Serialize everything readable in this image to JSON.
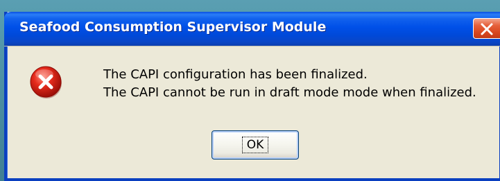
{
  "dialog": {
    "title": "Seafood Consumption Supervisor Module",
    "message_lines": [
      "The CAPI configuration has been finalized.",
      "The CAPI cannot be run in draft mode mode when finalized."
    ],
    "ok_label": "OK",
    "icon": "error-icon",
    "close_icon": "close-icon"
  },
  "colors": {
    "titlebar": "#0050e8",
    "dialog_bg": "#ece9d8",
    "close_button": "#d9471f",
    "error_red": "#d11a1a"
  }
}
